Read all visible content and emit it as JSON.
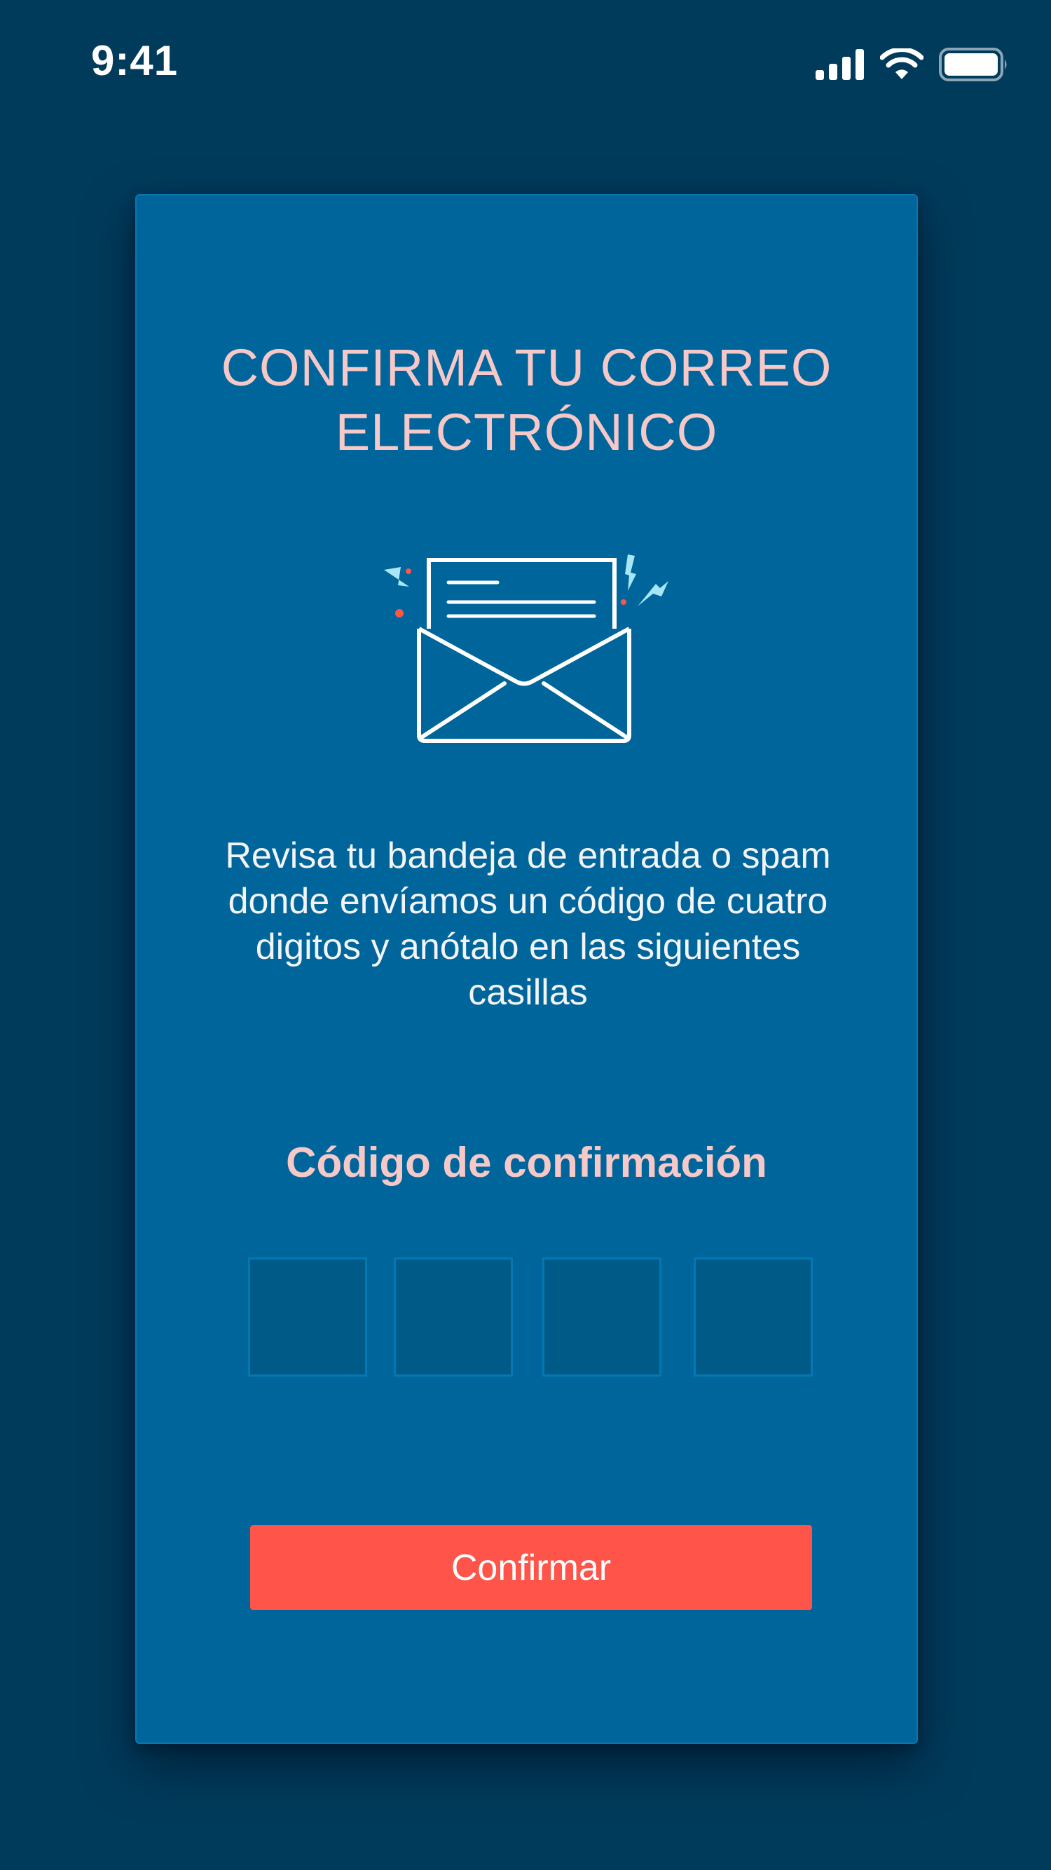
{
  "status_bar": {
    "time": "9:41"
  },
  "card": {
    "title": "CONFIRMA TU CORREO ELECTRÓNICO",
    "instructions": "Revisa tu bandeja de entrada o spam donde envíamos un código de cuatro digitos y anótalo en las siguientes casillas",
    "code_label": "Código de confirmación",
    "code_inputs": [
      {
        "value": ""
      },
      {
        "value": ""
      },
      {
        "value": ""
      },
      {
        "value": ""
      }
    ],
    "confirm_button": "Confirmar"
  },
  "colors": {
    "background": "#003b5c",
    "card": "#00659a",
    "accent_text": "#f7c8c8",
    "button": "#ff5449",
    "input_box": "#005a88"
  },
  "icons": {
    "signal": "cellular-signal-icon",
    "wifi": "wifi-icon",
    "battery": "battery-icon",
    "envelope": "open-envelope-icon"
  }
}
